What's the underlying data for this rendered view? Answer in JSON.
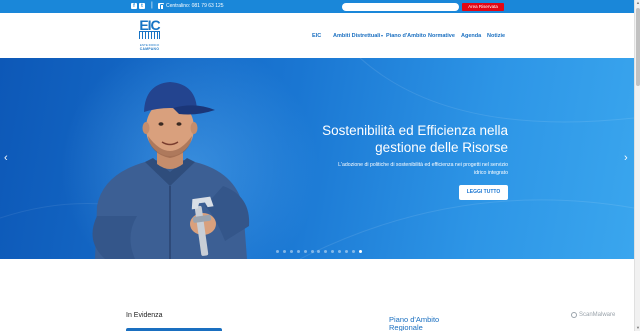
{
  "topbar": {
    "social": [
      {
        "icon": "facebook-icon",
        "glyph": "f"
      },
      {
        "icon": "twitter-icon",
        "glyph": "t"
      }
    ],
    "separator": "|",
    "phone_label": "Centralino: 081 79 63 125",
    "search_placeholder": "",
    "reserved_area_label": "Area Riservata"
  },
  "logo": {
    "letters": "EIC",
    "line1": "ENTE IDRICO",
    "line2": "CAMPANO"
  },
  "nav": {
    "items": [
      {
        "label": "EIC",
        "dropdown": false
      },
      {
        "label": "Ambiti Distrettuali",
        "dropdown": true
      },
      {
        "label": "Piano d'Ambito",
        "dropdown": false
      },
      {
        "label": "Normative",
        "dropdown": false
      },
      {
        "label": "Agenda",
        "dropdown": false
      },
      {
        "label": "Notizie",
        "dropdown": false
      }
    ]
  },
  "hero": {
    "title": "Sostenibilità ed Efficienza nella gestione delle Risorse",
    "text": "L'adozione di politiche di sostenibilità ed efficienza nei progetti nel servizio idrico integrato",
    "button_label": "LEGGI TUTTO",
    "prev_arrow": "‹",
    "next_arrow": "›",
    "slides_count": 13,
    "active_slide": 13
  },
  "sections": {
    "evidenza_title": "In Evidenza",
    "piano_title": "Piano d'Ambito Regionale"
  },
  "watermark": "ScanMalware",
  "colors": {
    "primary": "#1a87d9",
    "nav": "#1a6fc0",
    "reserved_button": "#e30613",
    "hero_dark": "#0d58b7",
    "hero_light": "#3aa6ee"
  }
}
